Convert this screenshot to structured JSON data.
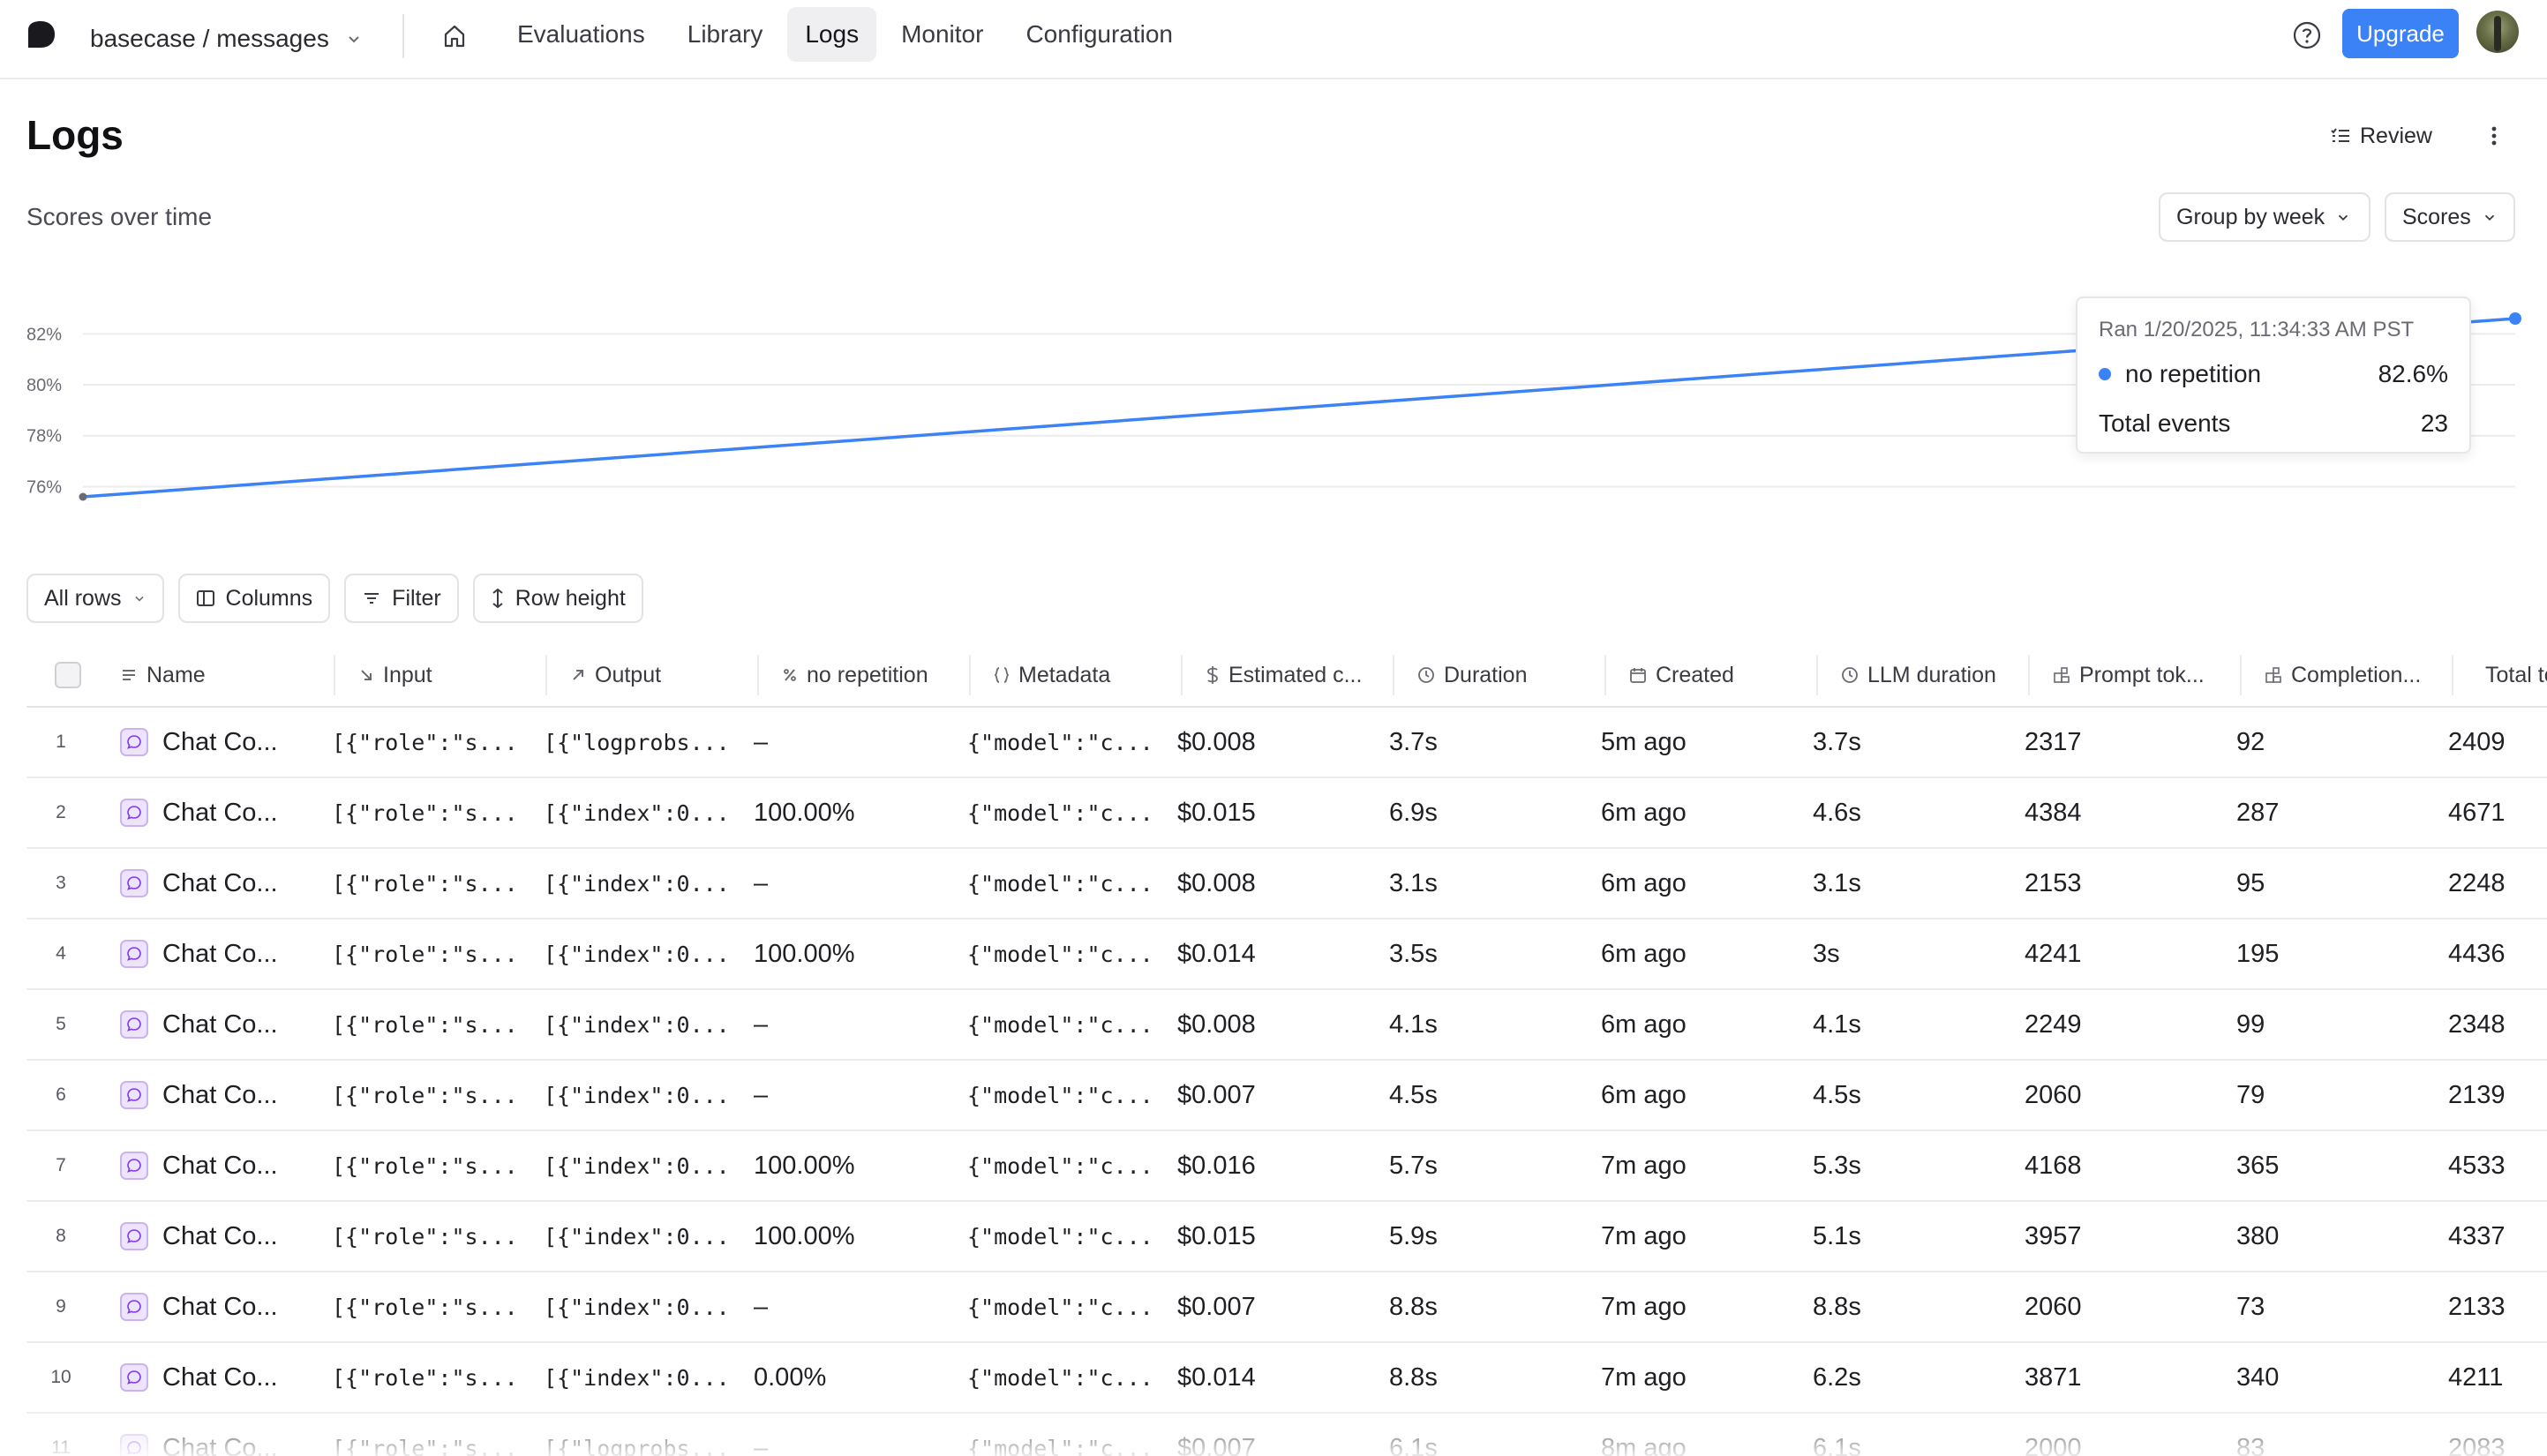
{
  "nav": {
    "project": "basecase / messages",
    "links": [
      "Evaluations",
      "Library",
      "Logs",
      "Monitor",
      "Configuration"
    ],
    "active_link": "Logs",
    "upgrade_label": "Upgrade"
  },
  "page": {
    "title": "Logs",
    "review_label": "Review",
    "chart_heading": "Scores over time",
    "group_by_label": "Group by week",
    "scores_label": "Scores"
  },
  "chart_data": {
    "type": "line",
    "y_ticks": [
      "82%",
      "80%",
      "78%",
      "76%"
    ],
    "ylim": [
      75.6,
      82.6
    ],
    "series": [
      {
        "name": "no repetition",
        "color": "#3b82f6",
        "values": [
          75.6,
          82.6
        ]
      }
    ],
    "tooltip": {
      "title": "Ran 1/20/2025, 11:34:33 AM PST",
      "series_name": "no repetition",
      "series_value": "82.6%",
      "total_label": "Total events",
      "total_value": "23"
    }
  },
  "toolbar": {
    "all_rows": "All rows",
    "columns": "Columns",
    "filter": "Filter",
    "row_height": "Row height"
  },
  "table": {
    "headers": [
      "Name",
      "Input",
      "Output",
      "no repetition",
      "Metadata",
      "Estimated c...",
      "Duration",
      "Created",
      "LLM duration",
      "Prompt tok...",
      "Completion...",
      "Total to"
    ],
    "rows": [
      [
        "1",
        "Chat Co...",
        "[{\"role\":\"s...",
        "[{\"logprobs...",
        "–",
        "{\"model\":\"c...",
        "$0.008",
        "3.7s",
        "5m ago",
        "3.7s",
        "2317",
        "92",
        "2409"
      ],
      [
        "2",
        "Chat Co...",
        "[{\"role\":\"s...",
        "[{\"index\":0...",
        "100.00%",
        "{\"model\":\"c...",
        "$0.015",
        "6.9s",
        "6m ago",
        "4.6s",
        "4384",
        "287",
        "4671"
      ],
      [
        "3",
        "Chat Co...",
        "[{\"role\":\"s...",
        "[{\"index\":0...",
        "–",
        "{\"model\":\"c...",
        "$0.008",
        "3.1s",
        "6m ago",
        "3.1s",
        "2153",
        "95",
        "2248"
      ],
      [
        "4",
        "Chat Co...",
        "[{\"role\":\"s...",
        "[{\"index\":0...",
        "100.00%",
        "{\"model\":\"c...",
        "$0.014",
        "3.5s",
        "6m ago",
        "3s",
        "4241",
        "195",
        "4436"
      ],
      [
        "5",
        "Chat Co...",
        "[{\"role\":\"s...",
        "[{\"index\":0...",
        "–",
        "{\"model\":\"c...",
        "$0.008",
        "4.1s",
        "6m ago",
        "4.1s",
        "2249",
        "99",
        "2348"
      ],
      [
        "6",
        "Chat Co...",
        "[{\"role\":\"s...",
        "[{\"index\":0...",
        "–",
        "{\"model\":\"c...",
        "$0.007",
        "4.5s",
        "6m ago",
        "4.5s",
        "2060",
        "79",
        "2139"
      ],
      [
        "7",
        "Chat Co...",
        "[{\"role\":\"s...",
        "[{\"index\":0...",
        "100.00%",
        "{\"model\":\"c...",
        "$0.016",
        "5.7s",
        "7m ago",
        "5.3s",
        "4168",
        "365",
        "4533"
      ],
      [
        "8",
        "Chat Co...",
        "[{\"role\":\"s...",
        "[{\"index\":0...",
        "100.00%",
        "{\"model\":\"c...",
        "$0.015",
        "5.9s",
        "7m ago",
        "5.1s",
        "3957",
        "380",
        "4337"
      ],
      [
        "9",
        "Chat Co...",
        "[{\"role\":\"s...",
        "[{\"index\":0...",
        "–",
        "{\"model\":\"c...",
        "$0.007",
        "8.8s",
        "7m ago",
        "8.8s",
        "2060",
        "73",
        "2133"
      ],
      [
        "10",
        "Chat Co...",
        "[{\"role\":\"s...",
        "[{\"index\":0...",
        "0.00%",
        "{\"model\":\"c...",
        "$0.014",
        "8.8s",
        "7m ago",
        "6.2s",
        "3871",
        "340",
        "4211"
      ],
      [
        "11",
        "Chat Co...",
        "[{\"role\":\"s...",
        "[{\"logprobs...",
        "–",
        "{\"model\":\"c...",
        "$0.007",
        "6.1s",
        "8m ago",
        "6.1s",
        "2000",
        "83",
        "2083"
      ]
    ]
  }
}
